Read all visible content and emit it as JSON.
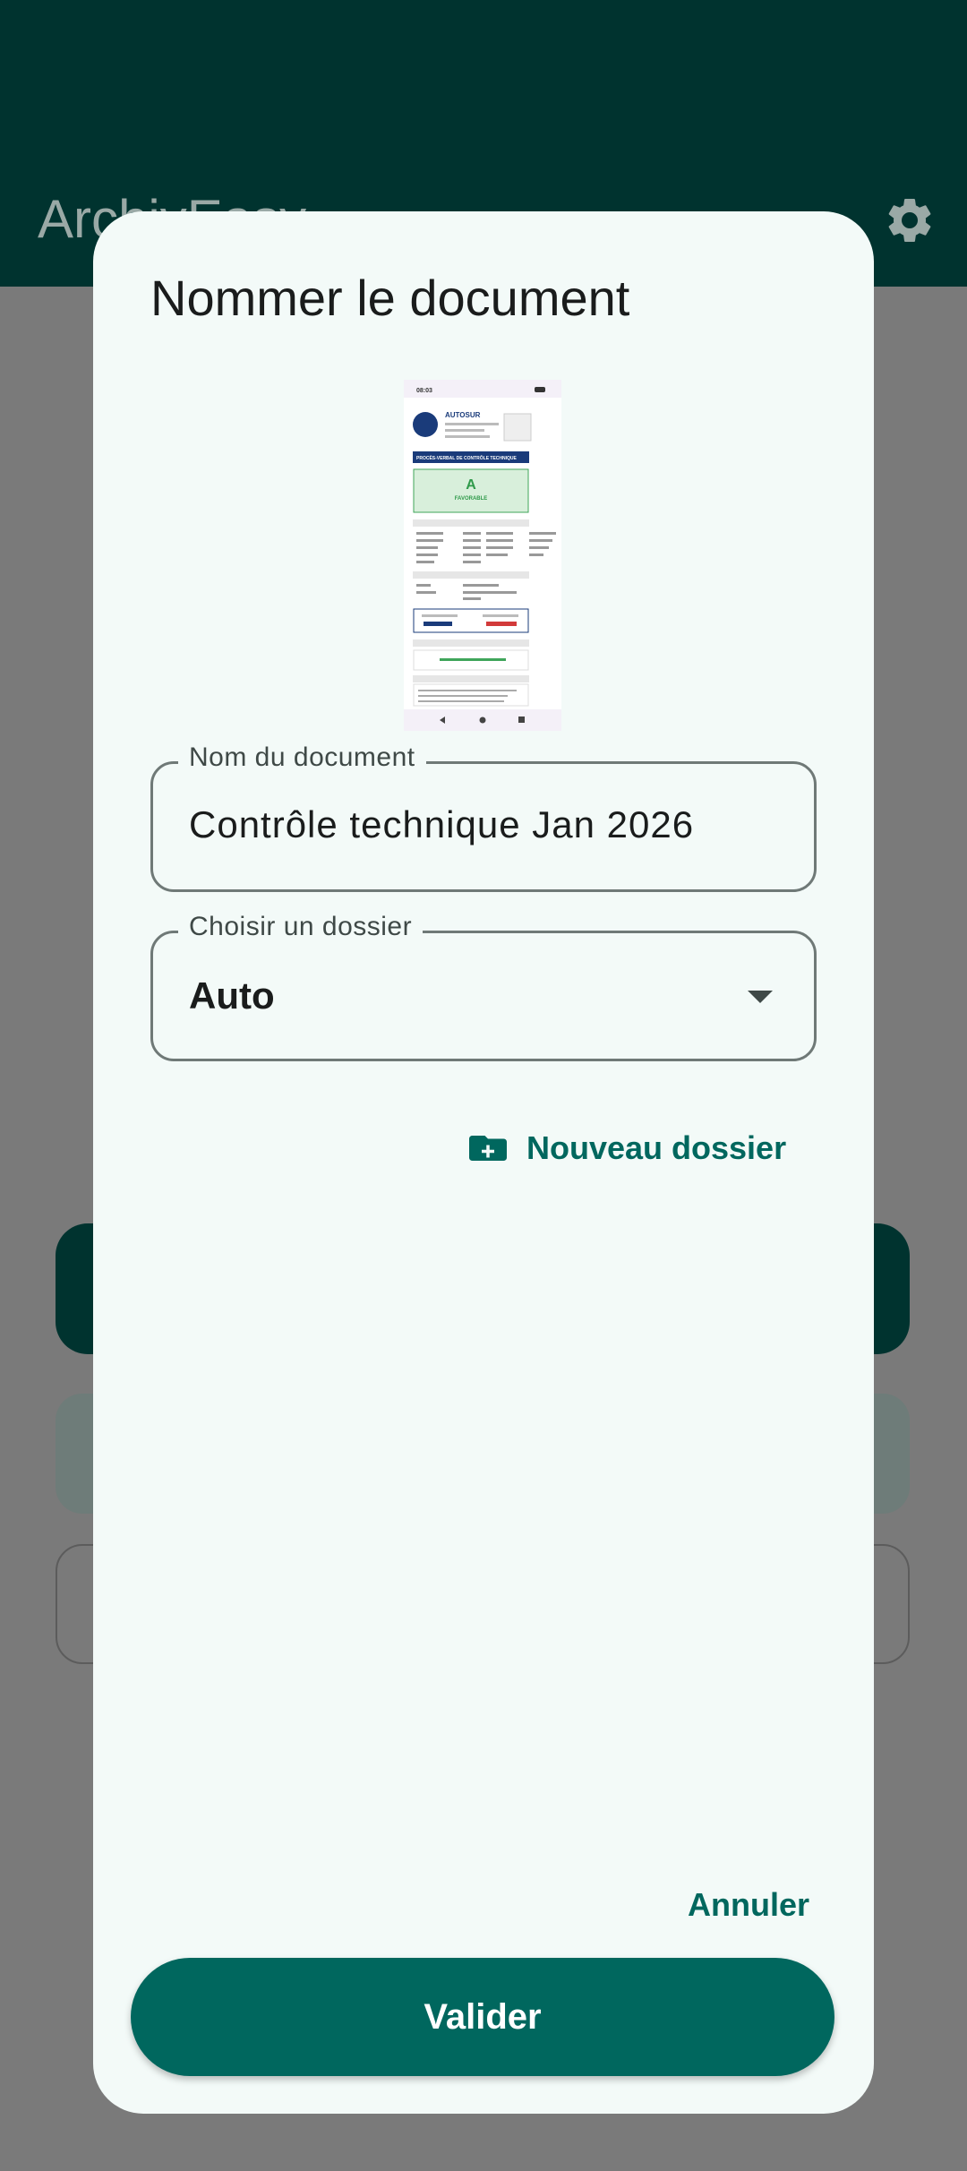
{
  "app": {
    "title": "ArchivEasy"
  },
  "dialog": {
    "title": "Nommer le document",
    "thumbnail": {
      "time": "08:03",
      "header": "AUTOSUR",
      "section_title": "PROCÈS-VERBAL DE CONTRÔLE TECHNIQUE",
      "grade": "A",
      "grade_label": "FAVORABLE"
    },
    "name_field": {
      "label": "Nom du document",
      "value": "Contrôle technique Jan 2026"
    },
    "folder_field": {
      "label": "Choisir un dossier",
      "value": "Auto"
    },
    "new_folder_label": "Nouveau dossier",
    "cancel_label": "Annuler",
    "validate_label": "Valider"
  },
  "colors": {
    "appbar": "#00332f",
    "accent": "#00675e",
    "dialog_bg": "#f3faf8",
    "scrim": "#7a7a7a"
  }
}
